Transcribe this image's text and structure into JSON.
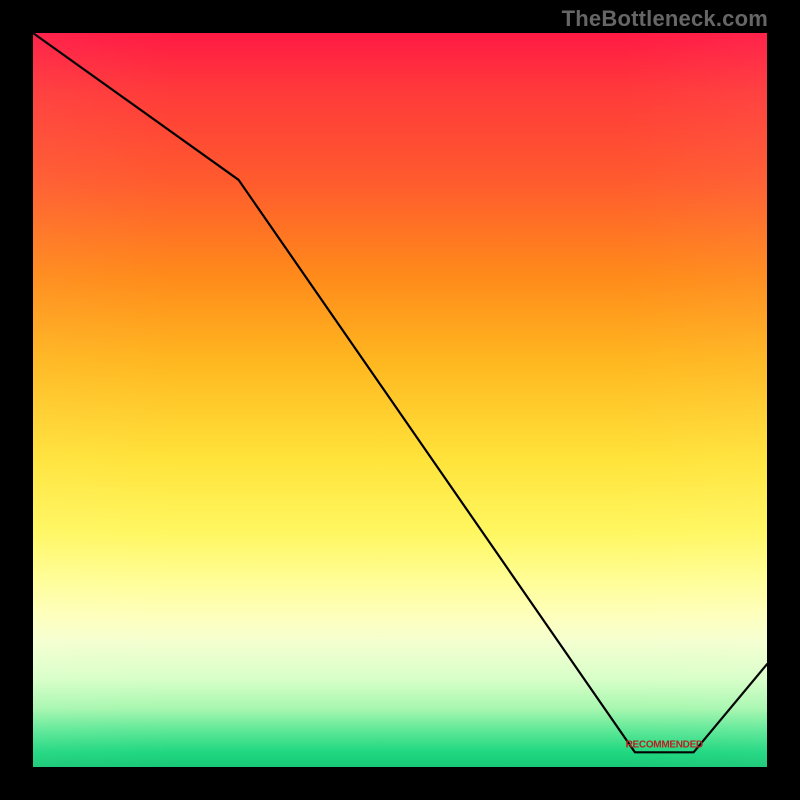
{
  "watermark": "TheBottleneck.com",
  "marker_label": "RECOMMENDED",
  "chart_data": {
    "type": "line",
    "title": "",
    "xlabel": "",
    "ylabel": "",
    "xlim": [
      0,
      100
    ],
    "ylim": [
      0,
      100
    ],
    "grid": false,
    "series": [
      {
        "name": "bottleneck-curve",
        "x": [
          0,
          28,
          82,
          90,
          100
        ],
        "y": [
          100,
          80,
          2,
          2,
          14
        ]
      }
    ],
    "annotations": [
      {
        "name": "recommended-marker",
        "x": 86,
        "y": 3
      }
    ]
  }
}
